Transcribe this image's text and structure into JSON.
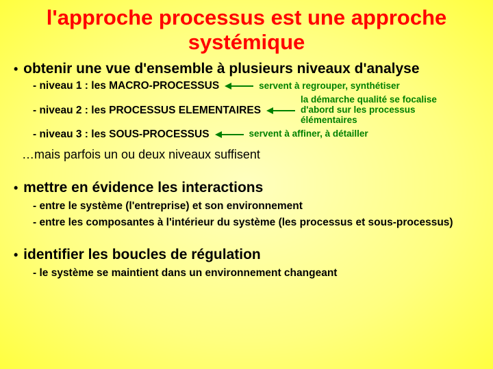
{
  "title_line1": "l'approche processus est une approche",
  "title_line2": "systémique",
  "sections": [
    {
      "heading": "obtenir une vue d'ensemble à plusieurs niveaux d'analyse",
      "levels": [
        {
          "label": "- niveau 1 : les MACRO-PROCESSUS",
          "annotation": "servent à regrouper, synthétiser"
        },
        {
          "label": "- niveau 2 : les PROCESSUS ELEMENTAIRES",
          "annotation": "la démarche qualité se focalise d'abord sur les processus élémentaires"
        },
        {
          "label": "- niveau 3 : les SOUS-PROCESSUS",
          "annotation": "servent à affiner, à détailler"
        }
      ],
      "note": "…mais parfois un ou deux niveaux suffisent"
    },
    {
      "heading": "mettre en évidence les interactions",
      "subs": [
        "- entre le système (l'entreprise) et son environnement",
        "- entre les composantes à l'intérieur du système (les processus et sous-processus)"
      ]
    },
    {
      "heading": "identifier les boucles de régulation",
      "subs": [
        "- le système se maintient dans un environnement changeant"
      ]
    }
  ]
}
